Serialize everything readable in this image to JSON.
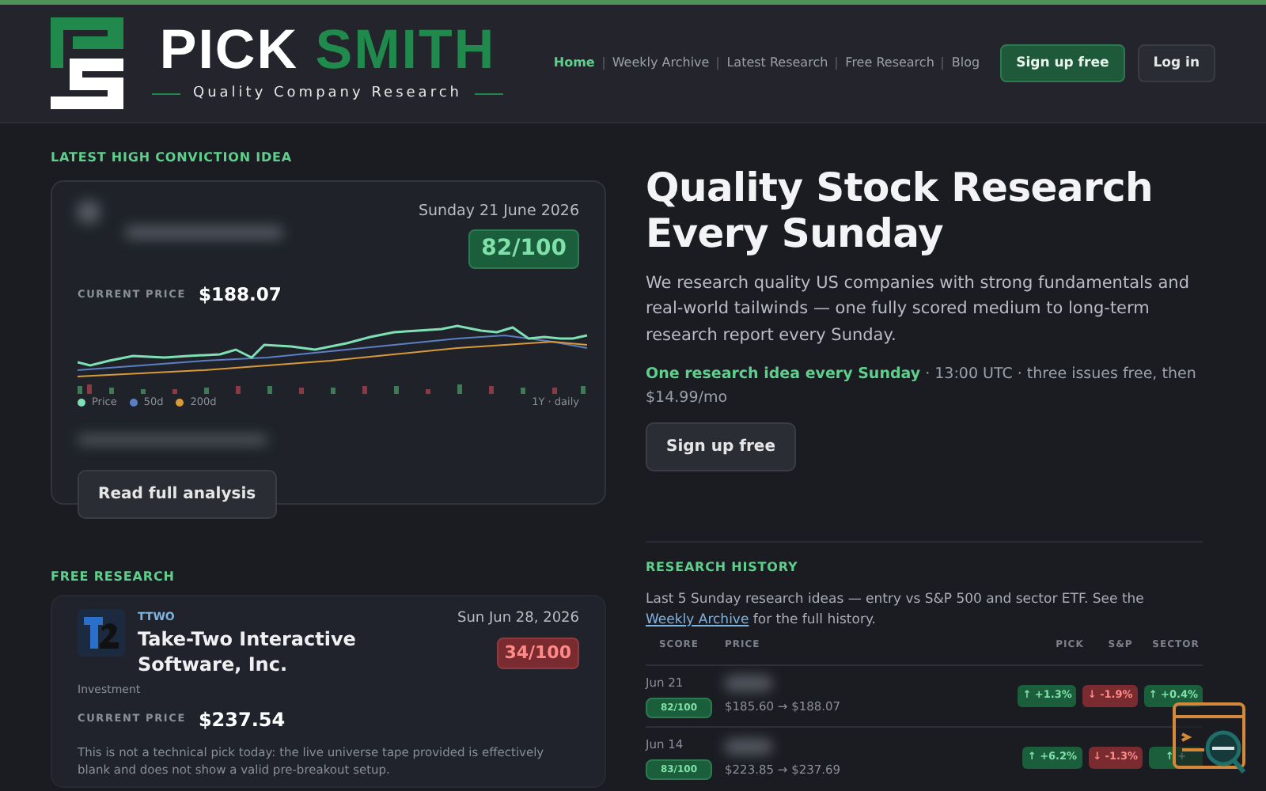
{
  "brand": {
    "name_first": "PICK",
    "name_second": "SMITH",
    "tagline": "Quality Company Research"
  },
  "nav": [
    {
      "label": "Home",
      "selected": true
    },
    {
      "label": "Weekly Archive",
      "selected": false
    },
    {
      "label": "Latest Research",
      "selected": false
    },
    {
      "label": "Free Research",
      "selected": false
    },
    {
      "label": "Blog",
      "selected": false
    }
  ],
  "header_buttons": [
    {
      "label": "Sign up free",
      "kind": "primary"
    },
    {
      "label": "Log in",
      "kind": "secondary"
    }
  ],
  "idea": {
    "section_label": "LATEST HIGH CONVICTION IDEA",
    "date": "Sunday 21 June 2026",
    "score": "82/100",
    "score_low": false,
    "price_label": "CURRENT PRICE",
    "price": "$188.07",
    "legend": [
      "Price",
      "50d",
      "200d"
    ],
    "range": "1Y · daily",
    "button": "Read full analysis"
  },
  "hero": {
    "title": "Quality Stock Research Every Sunday",
    "body": "We research quality US companies with strong fundamentals and real-world tailwinds — one fully scored medium to long-term research report every Sunday.",
    "highlight": "One research idea every Sunday",
    "schedule": " · 13:00 UTC · three issues free, then $14.99/mo",
    "button": "Sign up free"
  },
  "free_research": {
    "section_label": "FREE RESEARCH",
    "ticker": "TTWO",
    "company": "Take-Two Interactive Software, Inc.",
    "date": "Sun Jun 28, 2026",
    "score": "34/100",
    "score_low": true,
    "category": "Investment",
    "price_label": "CURRENT PRICE",
    "price": "$237.54",
    "summary": "This is not a technical pick today: the live universe tape provided is effectively blank and does not show a valid pre-breakout setup."
  },
  "history": {
    "section_label": "RESEARCH HISTORY",
    "intro_before": "Last 5 Sunday research ideas — entry vs S&P 500 and sector ETF. See the ",
    "link": "Weekly Archive",
    "intro_after": " for the full history.",
    "columns": [
      "SCORE",
      "PRICE",
      "PICK",
      "S&P",
      "SECTOR"
    ],
    "rows": [
      {
        "date": "Jun 21",
        "score": "82/100",
        "price": "$185.60 → $188.07",
        "changes": [
          {
            "text": "↑ +1.3%",
            "kind": "up"
          },
          {
            "text": "↓ -1.9%",
            "kind": "down"
          },
          {
            "text": "↑ +0.4%",
            "kind": "up"
          }
        ]
      },
      {
        "date": "Jun 14",
        "score": "83/100",
        "price": "$223.85 → $237.69",
        "changes": [
          {
            "text": "↑ +6.2%",
            "kind": "up"
          },
          {
            "text": "↓ -1.3%",
            "kind": "down"
          },
          {
            "text": "↑ +",
            "kind": "up"
          }
        ]
      }
    ]
  }
}
